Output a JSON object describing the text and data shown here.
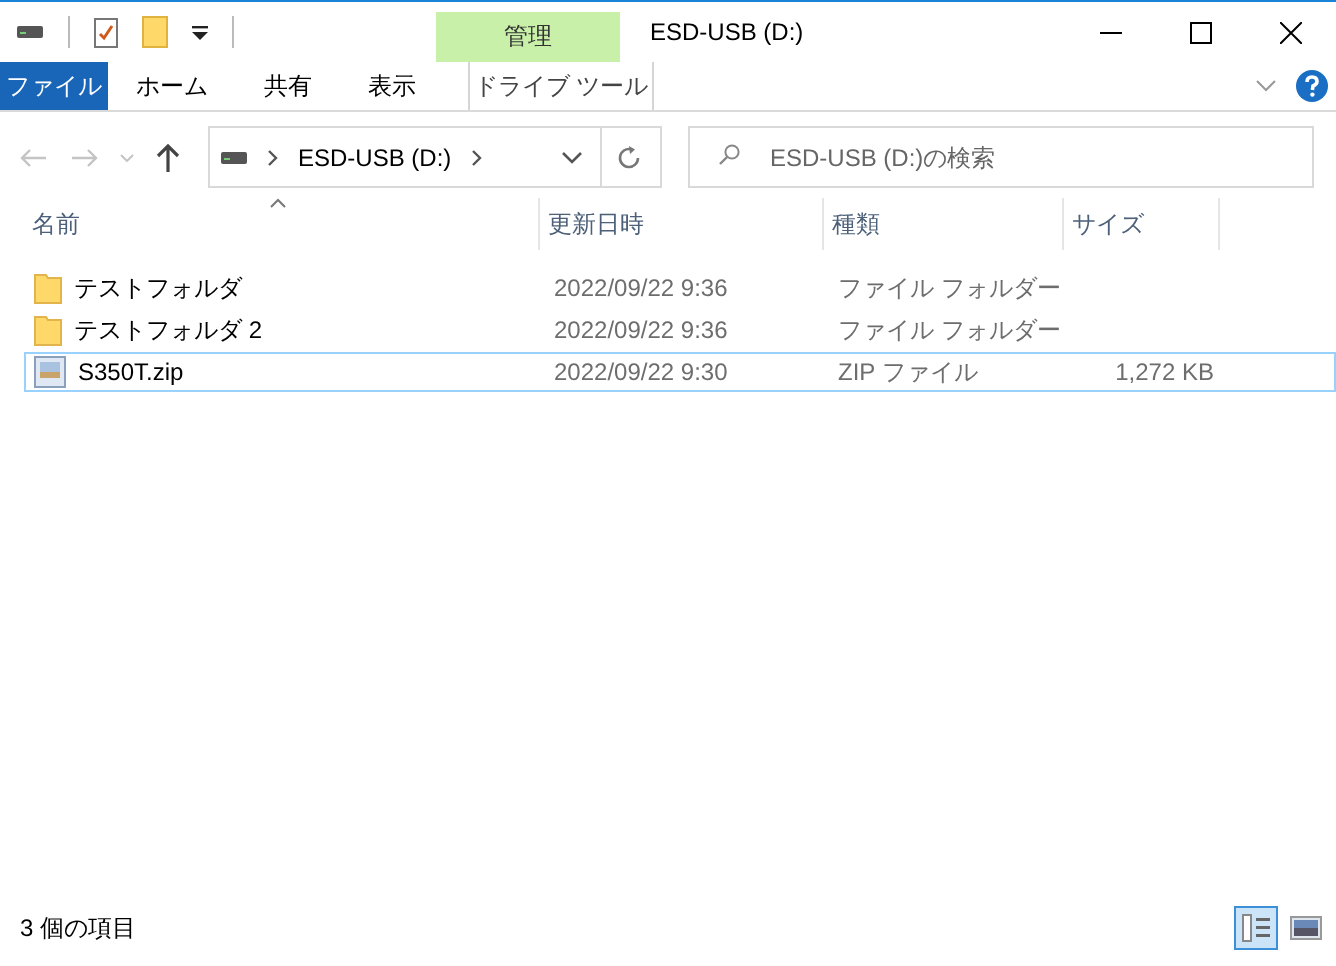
{
  "quick_access": [
    {
      "kind": "drive"
    },
    {
      "kind": "properties"
    },
    {
      "kind": "new-folder"
    },
    {
      "kind": "customize"
    }
  ],
  "contextual_tab": {
    "label": "管理"
  },
  "window": {
    "title": "ESD-USB (D:)"
  },
  "ribbon_tabs": [
    {
      "label": "ファイル",
      "kind": "file"
    },
    {
      "label": "ホーム",
      "kind": "tab"
    },
    {
      "label": "共有",
      "kind": "tab"
    },
    {
      "label": "表示",
      "kind": "tab"
    },
    {
      "label": "ドライブ ツール",
      "kind": "contextual"
    }
  ],
  "address_bar": {
    "path": [
      "ESD-USB (D:)"
    ]
  },
  "search": {
    "placeholder": "ESD-USB (D:)の検索"
  },
  "columns": [
    {
      "label": "名前",
      "sorted": true
    },
    {
      "label": "更新日時",
      "sorted": false
    },
    {
      "label": "種類",
      "sorted": false
    },
    {
      "label": "サイズ",
      "sorted": false
    }
  ],
  "files": [
    {
      "name": "テストフォルダ",
      "kind": "folder",
      "modified": "2022/09/22 9:36",
      "type": "ファイル フォルダー",
      "focused": false
    },
    {
      "name": "テストフォルダ 2",
      "kind": "folder",
      "modified": "2022/09/22 9:36",
      "type": "ファイル フォルダー",
      "focused": false
    },
    {
      "name": "S350T.zip",
      "kind": "zip",
      "modified": "2022/09/22 9:30",
      "type": "ZIP ファイル",
      "size": "1,272 KB",
      "focused": true
    }
  ],
  "status_bar": {
    "item_count": "3 個の項目"
  },
  "views": [
    {
      "kind": "details",
      "selected": true
    },
    {
      "kind": "large-icons",
      "selected": false
    }
  ]
}
